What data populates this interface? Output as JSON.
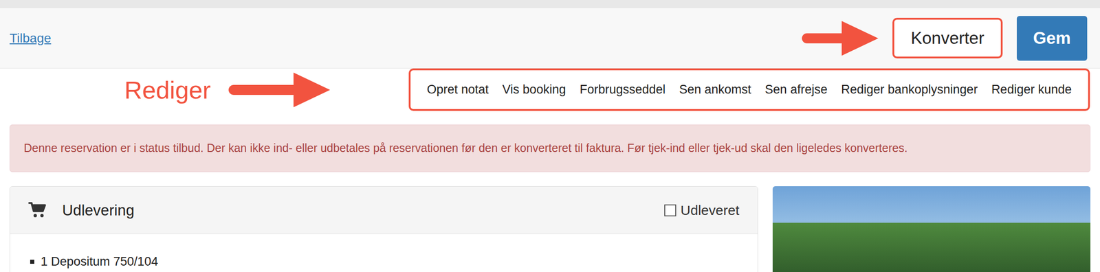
{
  "header": {
    "back_link": "Tilbage",
    "buttons": [
      {
        "label": "Konverter",
        "kind": "outline",
        "annotated": true
      },
      {
        "label": "Gem",
        "kind": "primary",
        "annotated": false
      }
    ]
  },
  "annotation": {
    "label": "Rediger"
  },
  "nav": {
    "links": [
      "Opret notat",
      "Vis booking",
      "Forbrugsseddel",
      "Sen ankomst",
      "Sen afrejse",
      "Rediger bankoplysninger",
      "Rediger kunde"
    ]
  },
  "alert": {
    "text": "Denne reservation er i status tilbud. Der kan ikke ind- eller udbetales på reservationen før den er konverteret til faktura. Før tjek-ind eller tjek-ud skal den ligeledes konverteres."
  },
  "panel": {
    "title": "Udlevering",
    "checkbox": {
      "label": "Udleveret",
      "checked": false
    },
    "items": [
      "1 Depositum 750/104"
    ]
  }
}
